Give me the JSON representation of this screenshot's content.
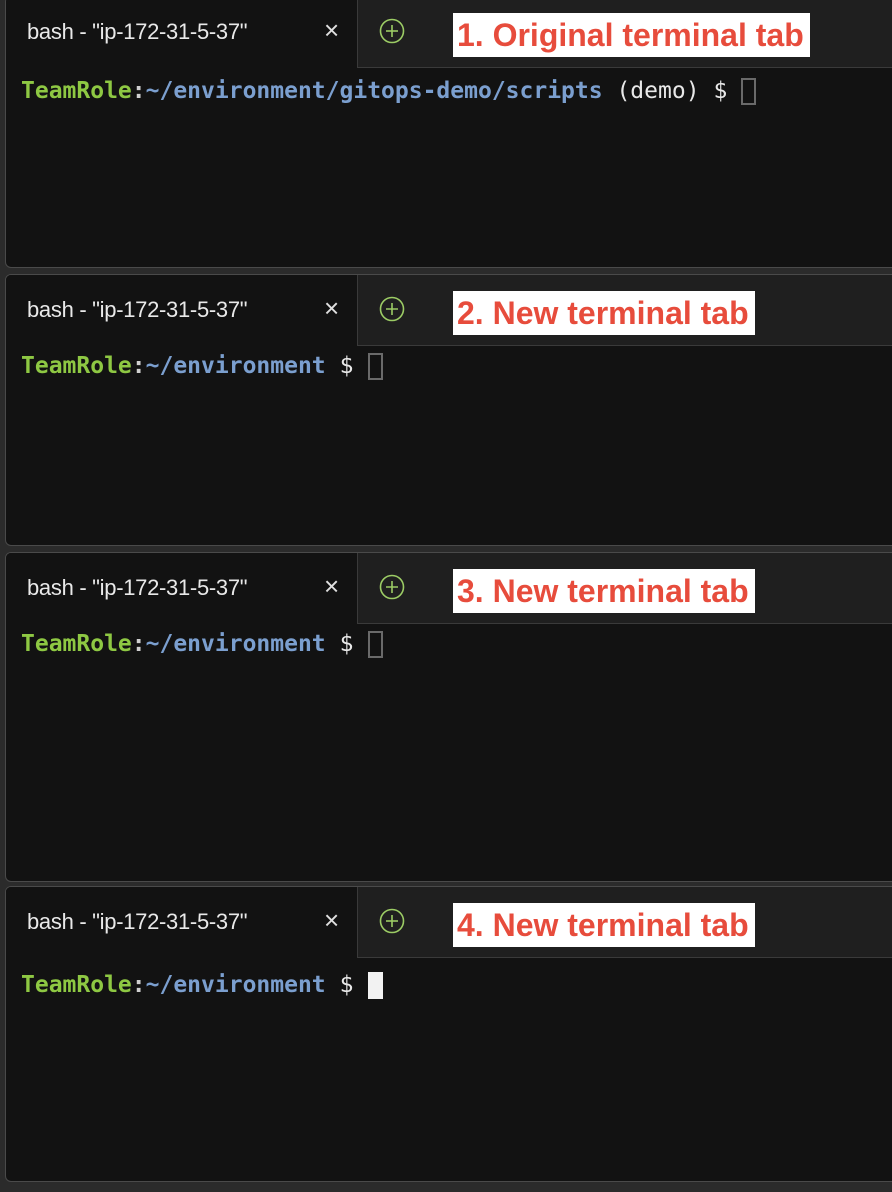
{
  "terminals": [
    {
      "tab_title": "bash - \"ip-172-31-5-37\"",
      "close_label": "×",
      "annotation": "1. Original terminal tab",
      "prompt_user": "TeamRole",
      "prompt_colon": ":",
      "prompt_path": "~/environment/gitops-demo/scripts",
      "prompt_extra": " (demo)",
      "prompt_symbol": "$",
      "cursor_focused": false
    },
    {
      "tab_title": "bash - \"ip-172-31-5-37\"",
      "close_label": "×",
      "annotation": "2. New terminal tab",
      "prompt_user": "TeamRole",
      "prompt_colon": ":",
      "prompt_path": "~/environment",
      "prompt_extra": "",
      "prompt_symbol": "$",
      "cursor_focused": false
    },
    {
      "tab_title": "bash - \"ip-172-31-5-37\"",
      "close_label": "×",
      "annotation": "3. New terminal tab",
      "prompt_user": "TeamRole",
      "prompt_colon": ":",
      "prompt_path": "~/environment",
      "prompt_extra": "",
      "prompt_symbol": "$",
      "cursor_focused": false
    },
    {
      "tab_title": "bash - \"ip-172-31-5-37\"",
      "close_label": "×",
      "annotation": "4. New terminal tab",
      "prompt_user": "TeamRole",
      "prompt_colon": ":",
      "prompt_path": "~/environment",
      "prompt_extra": "",
      "prompt_symbol": "$",
      "cursor_focused": true
    }
  ],
  "colors": {
    "annotation_text": "#e74c3c",
    "prompt_user": "#8ec843",
    "prompt_path": "#7b9fcf",
    "terminal_bg": "#121212",
    "new_tab_icon": "#9ccc65"
  },
  "icons": {
    "new_tab": "plus-circle-icon",
    "close": "close-icon"
  }
}
